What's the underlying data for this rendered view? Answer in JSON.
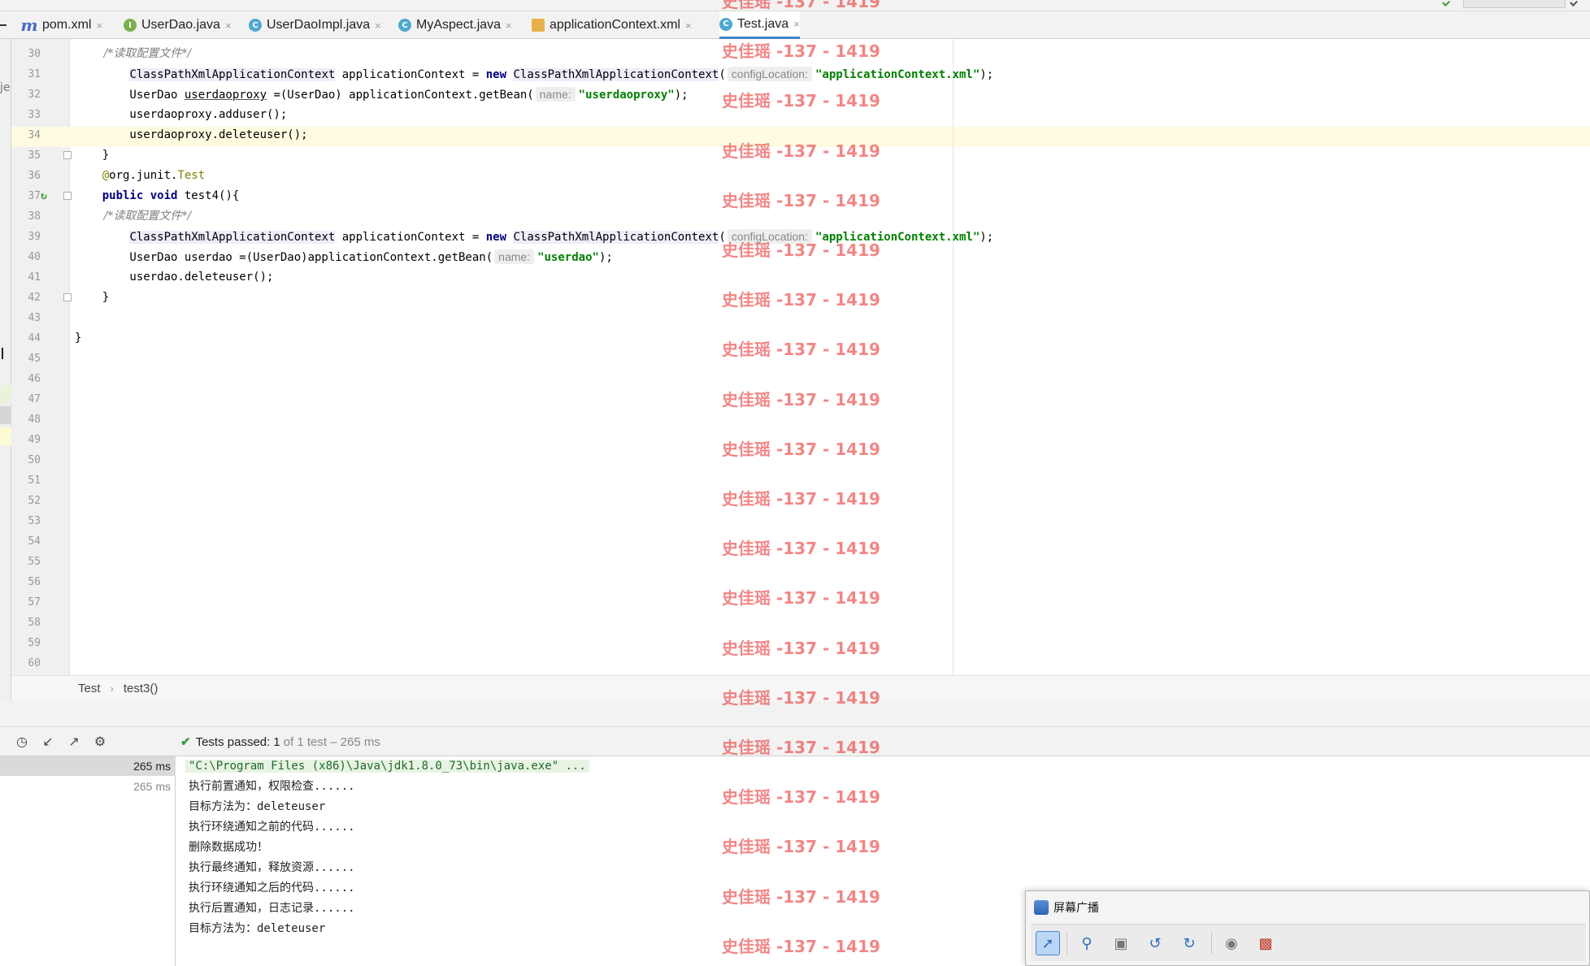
{
  "tabs": [
    {
      "label": "pom.xml",
      "icon": "maven-m-icon",
      "active": false
    },
    {
      "label": "UserDao.java",
      "icon": "interface-i-icon",
      "active": false
    },
    {
      "label": "UserDaoImpl.java",
      "icon": "class-c-icon",
      "active": false
    },
    {
      "label": "MyAspect.java",
      "icon": "class-c-icon",
      "active": false
    },
    {
      "label": "applicationContext.xml",
      "icon": "spring-xml-icon",
      "active": false
    },
    {
      "label": "Test.java",
      "icon": "class-c-icon",
      "active": true
    }
  ],
  "tab_close_glyph": "×",
  "left_panel_fragment": "je",
  "editor": {
    "lines": [
      {
        "num": "30",
        "parts": [
          {
            "cls": "cmt",
            "t": "        /*读取配置文件*/"
          }
        ]
      },
      {
        "num": "31",
        "parts": [
          {
            "cls": "",
            "t": "        "
          },
          {
            "cls": "hl-cls",
            "t": "ClassPathXmlApplicationContext"
          },
          {
            "cls": "",
            "t": " applicationContext = "
          },
          {
            "cls": "kw",
            "t": "new"
          },
          {
            "cls": "",
            "t": " "
          },
          {
            "cls": "hl-cls",
            "t": "ClassPathXmlApplicationContext"
          },
          {
            "cls": "",
            "t": "("
          },
          {
            "cls": "hint",
            "t": "configLocation:"
          },
          {
            "cls": "str",
            "t": "\"applicationContext.xml\""
          },
          {
            "cls": "",
            "t": ");"
          }
        ]
      },
      {
        "num": "32",
        "parts": [
          {
            "cls": "",
            "t": "        UserDao "
          },
          {
            "cls": "underline-var",
            "t": "userdaoproxy"
          },
          {
            "cls": "",
            "t": " =(UserDao) applicationContext.getBean("
          },
          {
            "cls": "hint",
            "t": "name:"
          },
          {
            "cls": "str",
            "t": "\"userdaoproxy\""
          },
          {
            "cls": "",
            "t": ");"
          }
        ]
      },
      {
        "num": "33",
        "parts": [
          {
            "cls": "",
            "t": "        userdaoproxy.adduser();"
          }
        ]
      },
      {
        "num": "34",
        "parts": [
          {
            "cls": "",
            "t": "        userdaoproxy.deleteuser();"
          }
        ]
      },
      {
        "num": "35",
        "parts": [
          {
            "cls": "",
            "t": "    }"
          }
        ]
      },
      {
        "num": "36",
        "parts": [
          {
            "cls": "",
            "t": "    "
          },
          {
            "cls": "ann",
            "t": "@"
          },
          {
            "cls": "",
            "t": "org.junit."
          },
          {
            "cls": "ann-cls",
            "t": "Test"
          }
        ]
      },
      {
        "num": "37",
        "parts": [
          {
            "cls": "",
            "t": "    "
          },
          {
            "cls": "kw",
            "t": "public"
          },
          {
            "cls": "",
            "t": " "
          },
          {
            "cls": "kw",
            "t": "void"
          },
          {
            "cls": "",
            "t": " test4(){"
          }
        ]
      },
      {
        "num": "38",
        "parts": [
          {
            "cls": "cmt",
            "t": "        /*读取配置文件*/"
          }
        ]
      },
      {
        "num": "39",
        "parts": [
          {
            "cls": "",
            "t": "        "
          },
          {
            "cls": "hl-cls",
            "t": "ClassPathXmlApplicationContext"
          },
          {
            "cls": "",
            "t": " applicationContext = "
          },
          {
            "cls": "kw",
            "t": "new"
          },
          {
            "cls": "",
            "t": " "
          },
          {
            "cls": "hl-cls",
            "t": "ClassPathXmlApplicationContext"
          },
          {
            "cls": "",
            "t": "("
          },
          {
            "cls": "hint",
            "t": "configLocation:"
          },
          {
            "cls": "str",
            "t": "\"applicationContext.xml\""
          },
          {
            "cls": "",
            "t": ");"
          }
        ]
      },
      {
        "num": "40",
        "parts": [
          {
            "cls": "",
            "t": "        UserDao userdao =(UserDao)applicationContext.getBean("
          },
          {
            "cls": "hint",
            "t": "name:"
          },
          {
            "cls": "str",
            "t": "\"userdao\""
          },
          {
            "cls": "",
            "t": ");"
          }
        ]
      },
      {
        "num": "41",
        "parts": [
          {
            "cls": "",
            "t": "        userdao.deleteuser();"
          }
        ]
      },
      {
        "num": "42",
        "parts": [
          {
            "cls": "",
            "t": "    }"
          }
        ]
      },
      {
        "num": "43",
        "parts": []
      },
      {
        "num": "44",
        "parts": [
          {
            "cls": "",
            "t": "}"
          }
        ]
      },
      {
        "num": "45",
        "parts": []
      },
      {
        "num": "46",
        "parts": []
      },
      {
        "num": "47",
        "parts": []
      },
      {
        "num": "48",
        "parts": []
      },
      {
        "num": "49",
        "parts": []
      },
      {
        "num": "50",
        "parts": []
      },
      {
        "num": "51",
        "parts": []
      },
      {
        "num": "52",
        "parts": []
      },
      {
        "num": "53",
        "parts": []
      },
      {
        "num": "54",
        "parts": []
      },
      {
        "num": "55",
        "parts": []
      },
      {
        "num": "56",
        "parts": []
      },
      {
        "num": "57",
        "parts": []
      },
      {
        "num": "58",
        "parts": []
      },
      {
        "num": "59",
        "parts": []
      },
      {
        "num": "60",
        "parts": []
      }
    ]
  },
  "breadcrumb": {
    "class_name": "Test",
    "separator": "›",
    "method_name": "test3()"
  },
  "run": {
    "status_label": "Tests passed:",
    "status_count": "1",
    "status_rest": "of 1 test – 265 ms",
    "tree_rows": [
      {
        "time": "265 ms",
        "selected": true
      },
      {
        "time": "265 ms",
        "selected": false
      }
    ],
    "console_lines": [
      "\"C:\\Program Files (x86)\\Java\\jdk1.8.0_73\\bin\\java.exe\" ...",
      "执行前置通知，权限检查......",
      "目标方法为：deleteuser",
      "执行环绕通知之前的代码......",
      "删除数据成功！",
      "执行最终通知，释放资源......",
      "执行环绕通知之后的代码......",
      "执行后置通知，日志记录......",
      "目标方法为：deleteuser"
    ]
  },
  "watermark": {
    "text": "史佳瑶 -137 - 1419",
    "color": "#e83c3c"
  },
  "broadcast": {
    "title": "屏幕广播"
  },
  "colors": {
    "accent": "#4083c9",
    "pass_green": "#3a9a3a",
    "keyword": "#000080",
    "string": "#008000"
  }
}
